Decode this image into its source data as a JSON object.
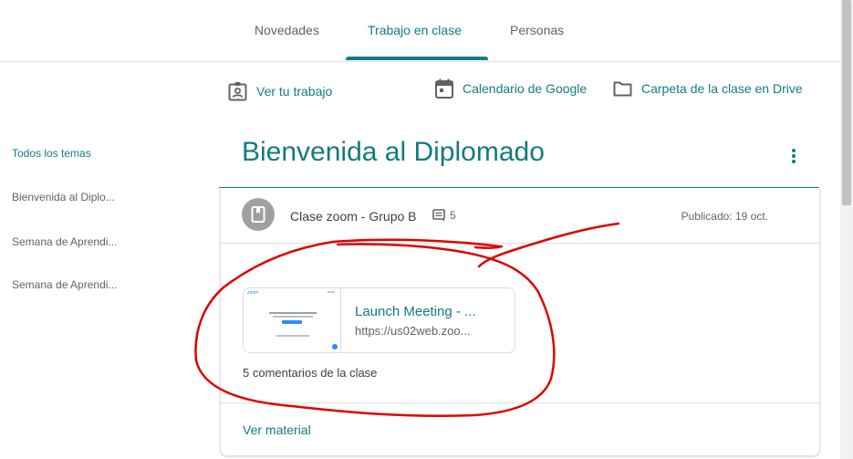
{
  "tabs": [
    {
      "label": "Novedades"
    },
    {
      "label": "Trabajo en clase"
    },
    {
      "label": "Personas"
    }
  ],
  "toolbar": {
    "your_work": "Ver tu trabajo",
    "google_calendar": "Calendario de Google",
    "drive_folder": "Carpeta de la clase en Drive"
  },
  "sidebar": {
    "items": [
      {
        "label": "Todos los temas"
      },
      {
        "label": "Bienvenida al Diplo..."
      },
      {
        "label": "Semana de Aprendi..."
      },
      {
        "label": "Semana de Aprendi..."
      }
    ]
  },
  "topic": {
    "title": "Bienvenida al Diplomado"
  },
  "material": {
    "title": "Clase zoom - Grupo B",
    "comment_count": "5",
    "published": "Publicado: 19 oct.",
    "link_title": "Launch Meeting - ...",
    "link_url": "https://us02web.zoo...",
    "class_comments": "5 comentarios de la clase",
    "view_material": "Ver material",
    "thumb_logo": "zoom"
  },
  "colors": {
    "accent": "#137b7f",
    "annotation": "#e00000"
  }
}
